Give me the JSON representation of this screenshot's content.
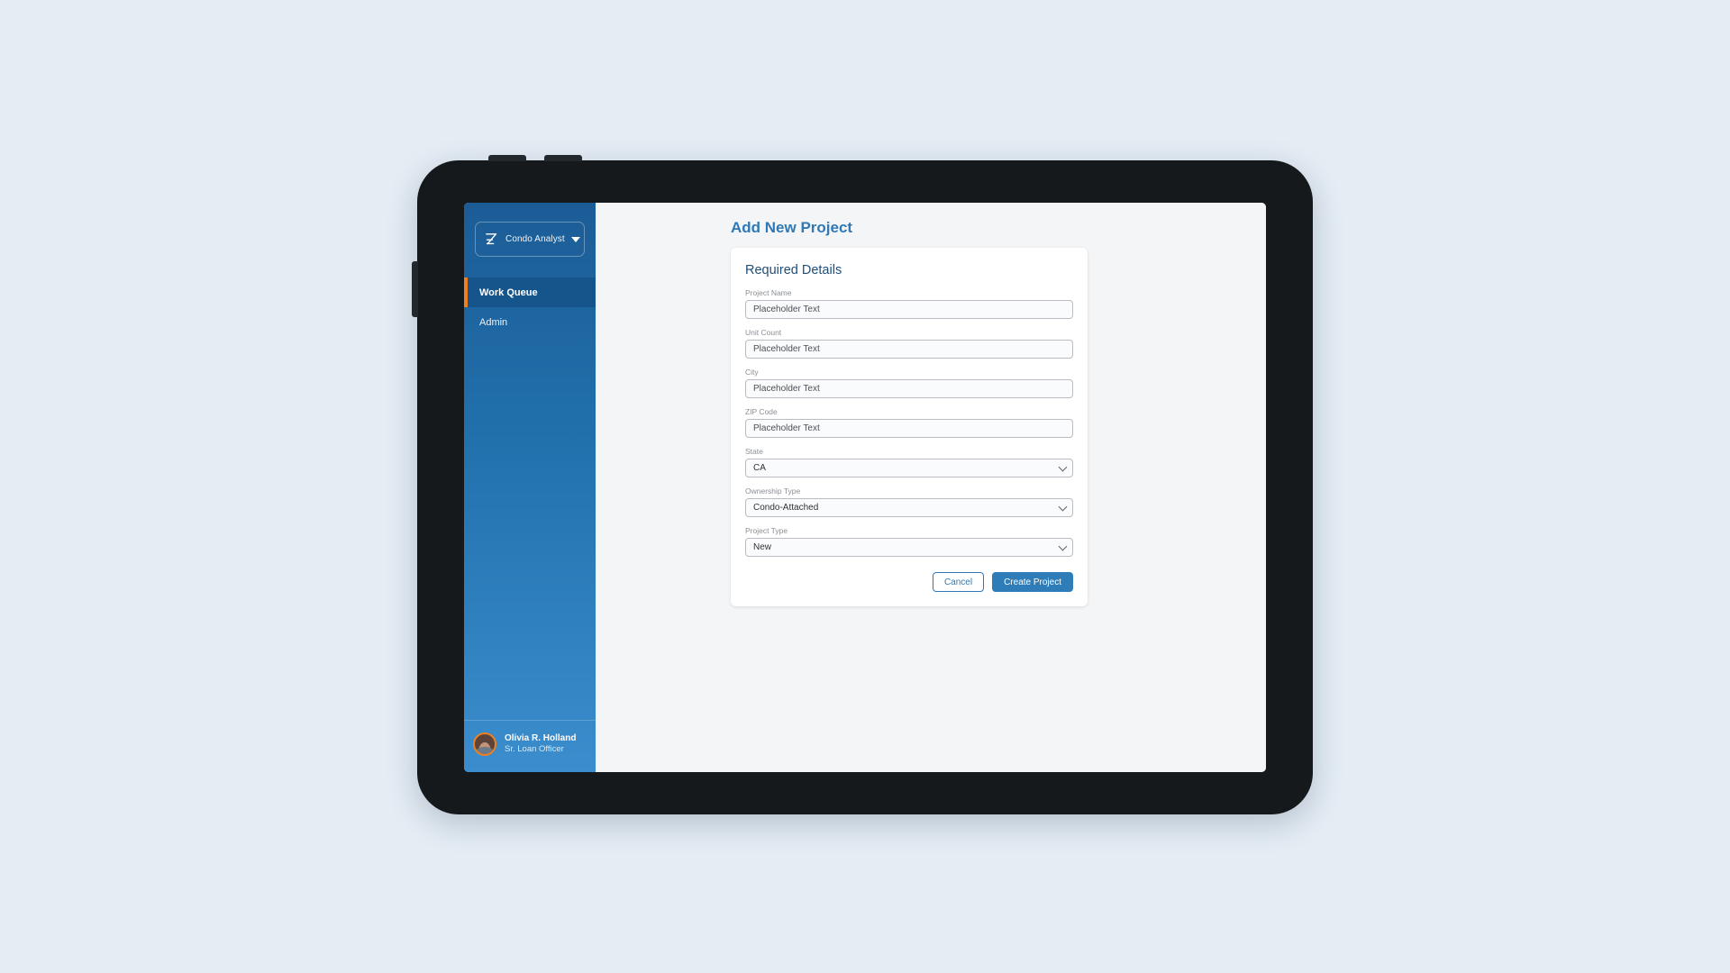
{
  "sidebar": {
    "brand": {
      "logo_icon": "z-logo-icon",
      "label": "Condo Analyst",
      "caret_icon": "chevron-down-icon"
    },
    "nav_items": [
      {
        "label": "Work Queue",
        "active": true
      },
      {
        "label": "Admin",
        "active": false
      }
    ],
    "user": {
      "name": "Olivia R. Holland",
      "role": "Sr. Loan Officer",
      "avatar_icon": "user-avatar"
    },
    "colors": {
      "gradient_top": "#1c5c96",
      "gradient_bottom": "#3b8dcd",
      "active_item_bg": "#16548c",
      "accent_bar": "#ef8022"
    }
  },
  "main": {
    "page_title": "Add New Project",
    "card": {
      "heading": "Required Details",
      "fields": [
        {
          "label": "Project Name",
          "type": "text",
          "value": "",
          "placeholder": "Placeholder Text"
        },
        {
          "label": "Unit Count",
          "type": "text",
          "value": "",
          "placeholder": "Placeholder Text"
        },
        {
          "label": "City",
          "type": "text",
          "value": "",
          "placeholder": "Placeholder Text"
        },
        {
          "label": "ZIP Code",
          "type": "text",
          "value": "",
          "placeholder": "Placeholder Text"
        },
        {
          "label": "State",
          "type": "select",
          "value": "CA"
        },
        {
          "label": "Ownership Type",
          "type": "select",
          "value": "Condo-Attached"
        },
        {
          "label": "Project Type",
          "type": "select",
          "value": "New"
        }
      ],
      "actions": {
        "cancel_label": "Cancel",
        "create_label": "Create Project"
      }
    },
    "colors": {
      "title_blue": "#3079b5",
      "heading_blue": "#1f4e79",
      "primary_button": "#2e7cb8",
      "page_bg": "#f4f5f6"
    }
  },
  "device": {
    "bezel_color": "#15191c",
    "background_color": "#e4ecf4"
  }
}
